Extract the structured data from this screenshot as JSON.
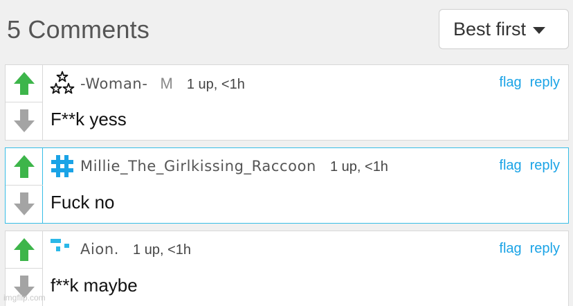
{
  "header": {
    "title": "5 Comments"
  },
  "sort": {
    "selected": "Best first"
  },
  "comments": [
    {
      "username": "-Woman-",
      "badge": "M",
      "points": "1 up, <1h",
      "flag_label": "flag",
      "reply_label": "reply",
      "text": "F**k yess",
      "avatar_icon": "stars-icon"
    },
    {
      "username": "Millie_The_Girlkissing_Raccoon",
      "points": "1 up, <1h",
      "flag_label": "flag",
      "reply_label": "reply",
      "text": "Fuck no",
      "avatar_icon": "hashtag-icon"
    },
    {
      "username": "Aion.",
      "points": "1 up, <1h",
      "flag_label": "flag",
      "reply_label": "reply",
      "text": "f**k maybe",
      "avatar_icon": "pixel-blocks-icon"
    }
  ],
  "colors": {
    "upvote": "#3db54a",
    "downvote": "#a4a4a4",
    "link": "#1aa3e6",
    "selected_border": "#36bde6"
  },
  "watermark": "imgflip.com"
}
